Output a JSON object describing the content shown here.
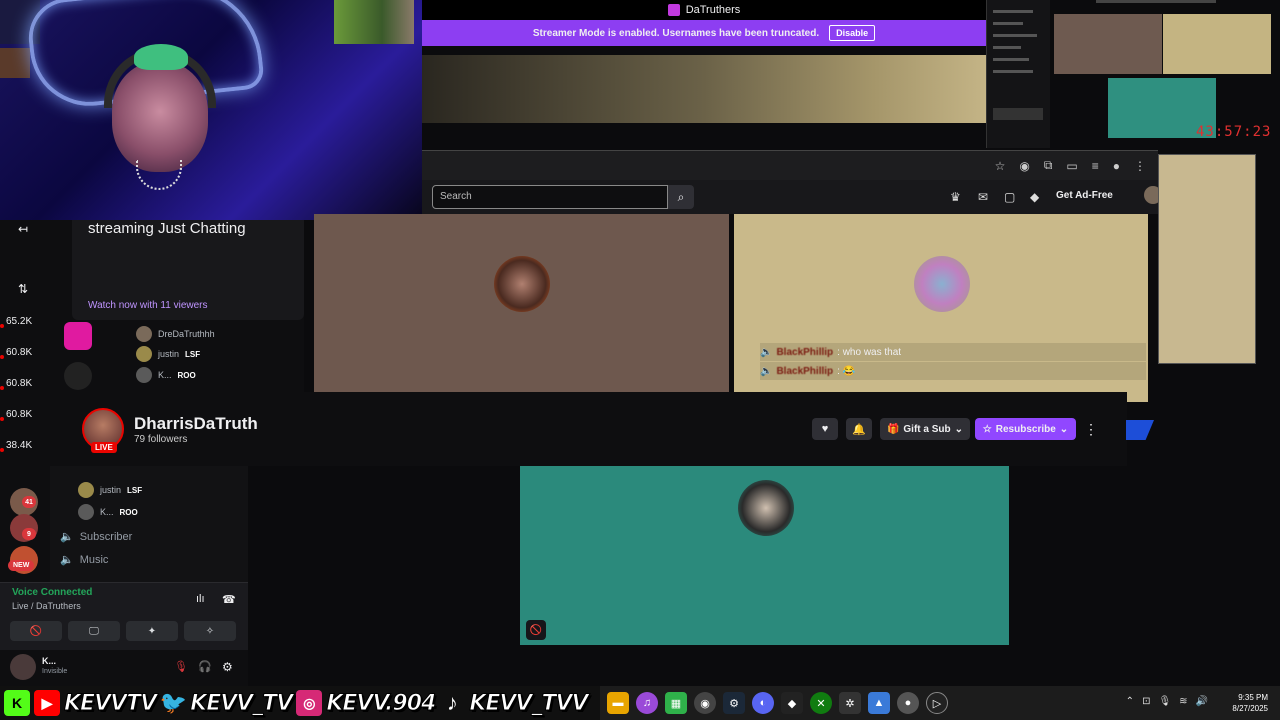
{
  "overlay": {
    "tab_title": "DaTruthers",
    "streamer_mode_text": "Streamer Mode is enabled. Usernames have been truncated.",
    "disable_label": "Disable",
    "timer": "43:57:23"
  },
  "browser": {
    "search_placeholder": "Search",
    "get_ad_free": "Get Ad-Free",
    "search_icon": "search-icon"
  },
  "tooltip": {
    "title": "streaming Just Chatting",
    "watch": "Watch now with 11 viewers"
  },
  "rail_counts": [
    "65.2K",
    "60.8K",
    "60.8K",
    "60.8K",
    "38.4K"
  ],
  "members_top": [
    {
      "name": "DreDaTruthhh",
      "badge": ""
    },
    {
      "name": "justin",
      "badge": "LSF"
    },
    {
      "name": "K...",
      "badge": "ROO"
    }
  ],
  "stream_chat": [
    {
      "user": "BlackPhillip",
      "msg": ": who was that"
    },
    {
      "user": "BlackPhillip",
      "msg": ": 😂"
    }
  ],
  "channel": {
    "name": "DharrisDaTruth",
    "followers": "79 followers",
    "live": "LIVE",
    "gift_label": "Gift a Sub",
    "resub_label": "Resubscribe"
  },
  "discord": {
    "members_bottom": [
      {
        "name": "DreDaTruthhh",
        "badge": ""
      },
      {
        "name": "justin",
        "badge": "LSF"
      },
      {
        "name": "K...",
        "badge": "ROO"
      }
    ],
    "channels": [
      "Subscriber",
      "Music"
    ],
    "voice_status": "Voice Connected",
    "voice_sub": "Live / DaTruthers",
    "server_badges": [
      "41",
      "9"
    ],
    "new_badge": "NEW",
    "user_name": "K...",
    "user_status": "Invisible"
  },
  "socials": [
    {
      "icon": "kick-icon",
      "text": "",
      "color": "#53fc18"
    },
    {
      "icon": "youtube-icon",
      "text": "KEVVTV",
      "color": "#ff0000"
    },
    {
      "icon": "twitter-icon",
      "text": "KEVV_TV",
      "color": "#1da1f2"
    },
    {
      "icon": "instagram-icon",
      "text": "KEVV.904",
      "color": "#d62976"
    },
    {
      "icon": "tiktok-icon",
      "text": "KEVV_TVV",
      "color": "#000000"
    }
  ],
  "taskbar": {
    "time": "9:35 PM",
    "date": "8/27/2025"
  },
  "colors": {
    "twitch_purple": "#9147ff",
    "streamer_bar": "#8d3ef2",
    "live_red": "#eb0400",
    "discord_green": "#23a55a"
  }
}
